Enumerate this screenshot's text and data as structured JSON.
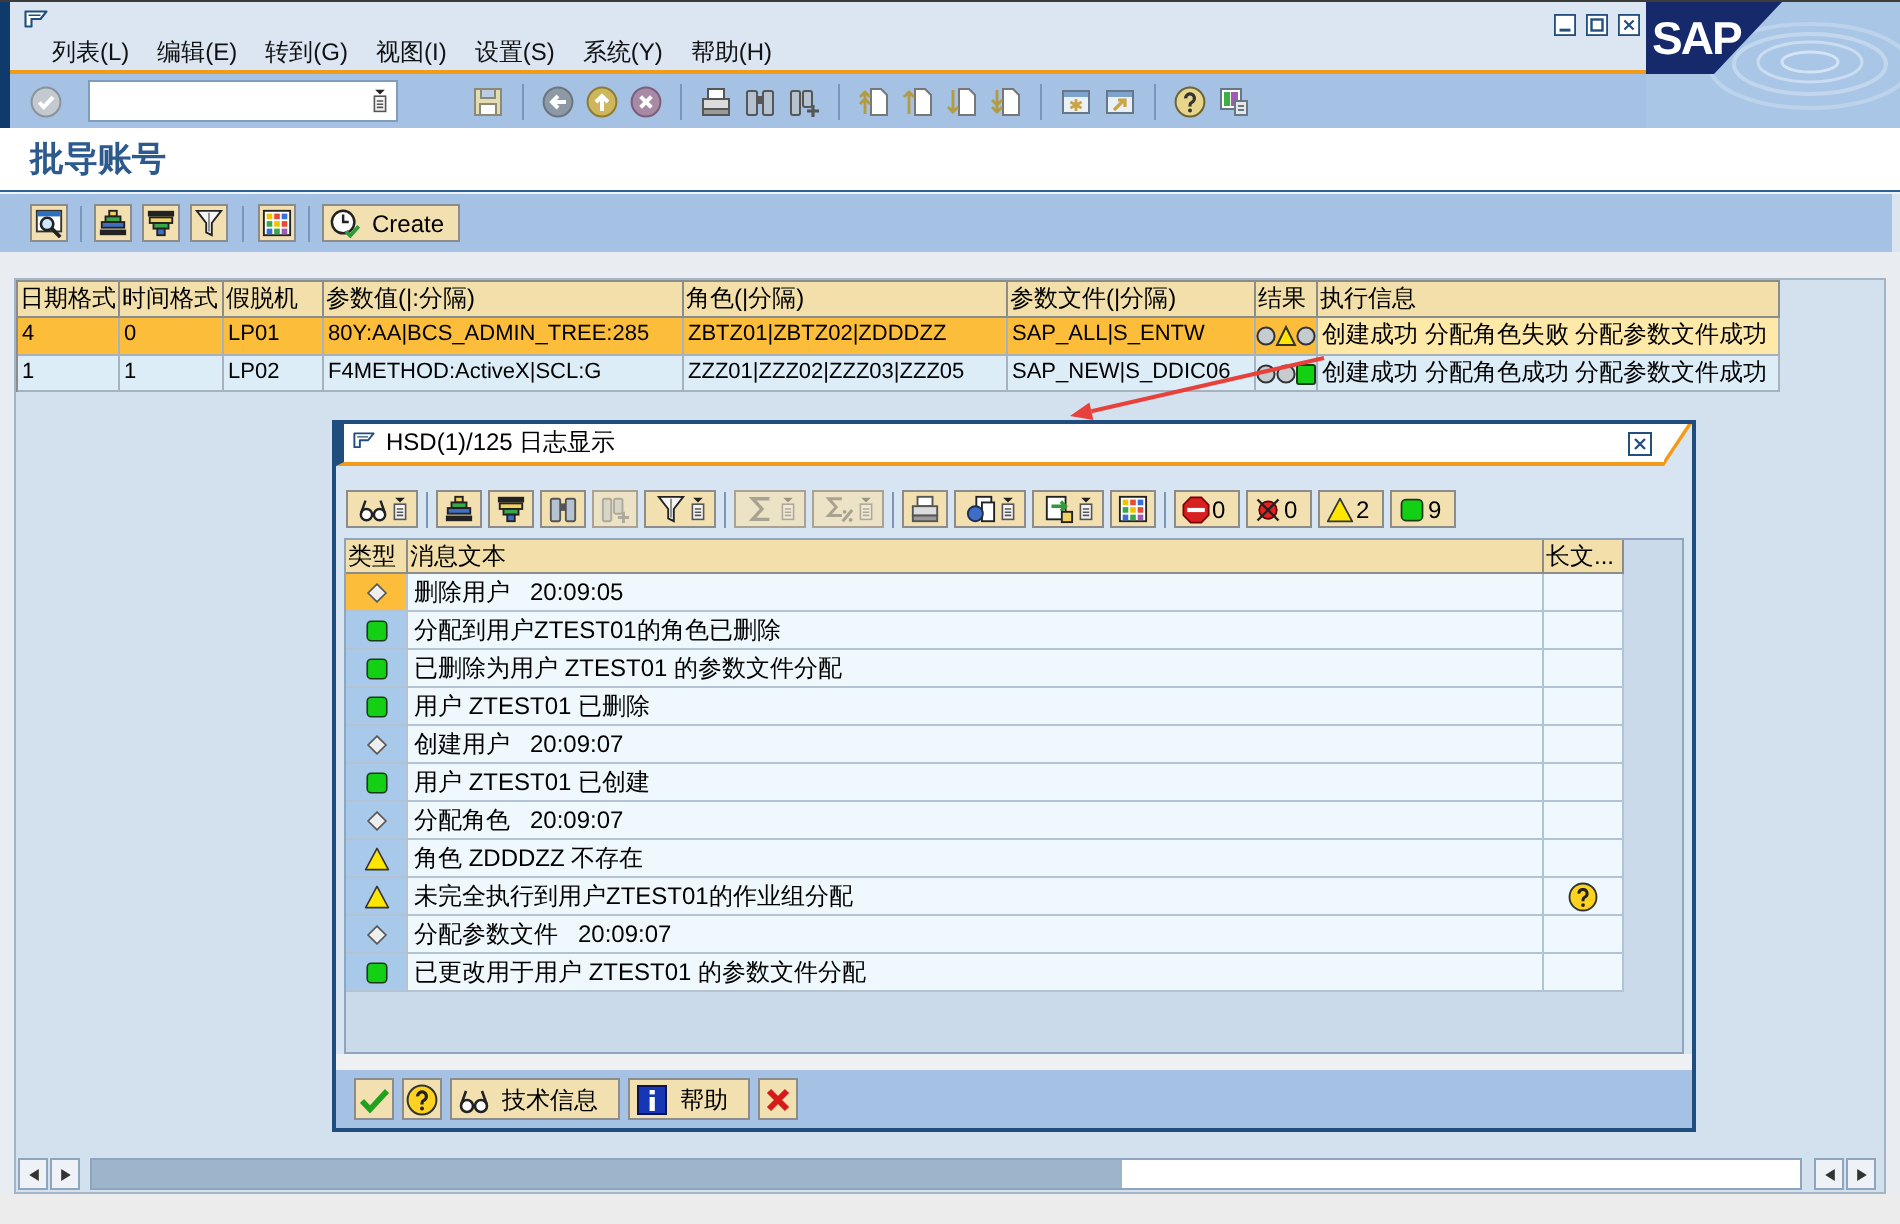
{
  "window": {
    "menu": [
      "列表(L)",
      "编辑(E)",
      "转到(G)",
      "视图(I)",
      "设置(S)",
      "系统(Y)",
      "帮助(H)"
    ],
    "logo": "SAP"
  },
  "screen_title": "批导账号",
  "app_toolbar": {
    "create_button": "Create"
  },
  "table": {
    "columns": [
      "日期格式",
      "时间格式",
      "假脱机",
      "参数值(|:分隔)",
      "角色(|分隔)",
      "参数文件(|分隔)",
      "结果",
      "执行信息"
    ],
    "rows": [
      {
        "selected": true,
        "cells": [
          "4",
          "0",
          "LP01",
          "80Y:AA|BCS_ADMIN_TREE:285",
          "ZBTZ01|ZBTZ02|ZDDDZZ",
          "SAP_ALL|S_ENTW"
        ],
        "result": {
          "kind": "warning"
        },
        "info": "创建成功 分配角色失败 分配参数文件成功"
      },
      {
        "selected": false,
        "cells": [
          "1",
          "1",
          "LP02",
          "F4METHOD:ActiveX|SCL:G",
          "ZZZ01|ZZZ02|ZZZ03|ZZZ05",
          "SAP_NEW|S_DDIC06"
        ],
        "result": {
          "kind": "success"
        },
        "info": "创建成功 分配角色成功 分配参数文件成功"
      }
    ]
  },
  "dialog": {
    "title": "HSD(1)/125 日志显示",
    "toolbar": [
      [
        {
          "kind": "details",
          "disabled": false,
          "menu": true
        }
      ],
      [
        {
          "kind": "sortup",
          "disabled": false,
          "menu": false
        },
        {
          "kind": "sortdown",
          "disabled": false,
          "menu": false
        },
        {
          "kind": "find",
          "disabled": false,
          "menu": false
        },
        {
          "kind": "findnext",
          "disabled": true,
          "menu": false
        },
        {
          "kind": "filter",
          "disabled": false,
          "menu": true
        }
      ],
      [
        {
          "kind": "sum",
          "disabled": true,
          "menu": true
        },
        {
          "kind": "subtotal",
          "disabled": true,
          "menu": true
        }
      ],
      [
        {
          "kind": "print",
          "disabled": false,
          "menu": false
        },
        {
          "kind": "views",
          "disabled": false,
          "menu": true
        },
        {
          "kind": "export",
          "disabled": false,
          "menu": true
        },
        {
          "kind": "grid",
          "disabled": false,
          "menu": false
        }
      ]
    ],
    "counters": [
      {
        "kind": "stop",
        "count": "0"
      },
      {
        "kind": "error",
        "count": "0"
      },
      {
        "kind": "warning",
        "count": "2"
      },
      {
        "kind": "success",
        "count": "9"
      }
    ],
    "columns": [
      "类型",
      "消息文本",
      "长文..."
    ],
    "messages": [
      {
        "kind": "info",
        "selected": true,
        "long_text": false,
        "text": "删除用户   20:09:05"
      },
      {
        "kind": "success",
        "selected": false,
        "long_text": false,
        "text": "分配到用户ZTEST01的角色已删除"
      },
      {
        "kind": "success",
        "selected": false,
        "long_text": false,
        "text": "已删除为用户 ZTEST01 的参数文件分配"
      },
      {
        "kind": "success",
        "selected": false,
        "long_text": false,
        "text": "用户 ZTEST01 已删除"
      },
      {
        "kind": "info",
        "selected": false,
        "long_text": false,
        "text": "创建用户   20:09:07"
      },
      {
        "kind": "success",
        "selected": false,
        "long_text": false,
        "text": "用户 ZTEST01 已创建"
      },
      {
        "kind": "info",
        "selected": false,
        "long_text": false,
        "text": "分配角色   20:09:07"
      },
      {
        "kind": "warning",
        "selected": false,
        "long_text": false,
        "text": "角色 ZDDDZZ 不存在"
      },
      {
        "kind": "warning",
        "selected": false,
        "long_text": true,
        "text": "未完全执行到用户ZTEST01的作业组分配"
      },
      {
        "kind": "info",
        "selected": false,
        "long_text": false,
        "text": "分配参数文件   20:09:07"
      },
      {
        "kind": "success",
        "selected": false,
        "long_text": false,
        "text": "已更改用于用户 ZTEST01 的参数文件分配"
      }
    ],
    "buttons": [
      {
        "kind": "ok"
      },
      {
        "kind": "help"
      },
      {
        "kind": "tech",
        "label": "技术信息"
      },
      {
        "kind": "info",
        "label": "帮助"
      },
      {
        "kind": "cancel"
      }
    ]
  }
}
